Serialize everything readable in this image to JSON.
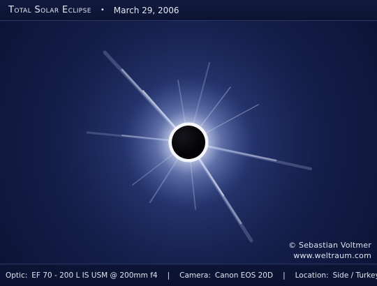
{
  "header": {
    "title": "Total Solar Eclipse",
    "separator": "•",
    "date": "March 29, 2006"
  },
  "photo": {
    "copyright": "© Sebastian Voltmer",
    "website": "www.weltraum.com"
  },
  "footer": {
    "optic_label": "Optic:",
    "optic_value": "EF 70 - 200 L IS USM @ 200mm f4",
    "separator": "|",
    "camera_label": "Camera:",
    "camera_value": "Canon EOS 20D",
    "location_label": "Location:",
    "location_value": "Side / Turkey"
  },
  "colors": {
    "sky": "#1a2758",
    "corona": "#dfe8ff",
    "moon": "#050507"
  }
}
